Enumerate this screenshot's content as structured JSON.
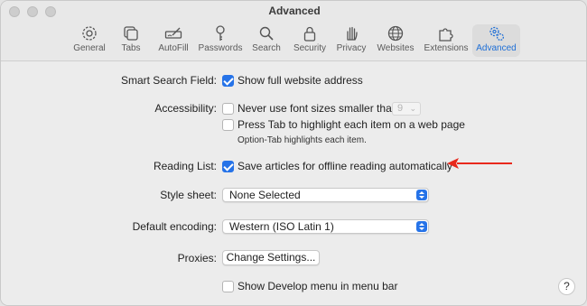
{
  "window": {
    "title": "Advanced"
  },
  "tabs": [
    {
      "label": "General",
      "icon": "gear-icon"
    },
    {
      "label": "Tabs",
      "icon": "tabs-icon"
    },
    {
      "label": "AutoFill",
      "icon": "autofill-icon"
    },
    {
      "label": "Passwords",
      "icon": "key-icon"
    },
    {
      "label": "Search",
      "icon": "magnifier-icon"
    },
    {
      "label": "Security",
      "icon": "lock-icon"
    },
    {
      "label": "Privacy",
      "icon": "hand-icon"
    },
    {
      "label": "Websites",
      "icon": "globe-icon"
    },
    {
      "label": "Extensions",
      "icon": "puzzle-icon"
    },
    {
      "label": "Advanced",
      "icon": "gears-icon",
      "selected": true
    }
  ],
  "settings": {
    "smart_search": {
      "label": "Smart Search Field:",
      "option": "Show full website address",
      "checked": true
    },
    "accessibility": {
      "label": "Accessibility:",
      "font_option": "Never use font sizes smaller than",
      "font_size": "9",
      "font_checked": false,
      "tab_option": "Press Tab to highlight each item on a web page",
      "tab_checked": false,
      "hint": "Option-Tab highlights each item."
    },
    "reading_list": {
      "label": "Reading List:",
      "option": "Save articles for offline reading automatically",
      "checked": true
    },
    "style_sheet": {
      "label": "Style sheet:",
      "value": "None Selected"
    },
    "encoding": {
      "label": "Default encoding:",
      "value": "Western (ISO Latin 1)"
    },
    "proxies": {
      "label": "Proxies:",
      "button": "Change Settings..."
    },
    "develop_menu": {
      "option": "Show Develop menu in menu bar",
      "checked": false
    }
  },
  "help": "?",
  "colors": {
    "accent": "#2673e8",
    "annotation_arrow": "#e8291c"
  }
}
